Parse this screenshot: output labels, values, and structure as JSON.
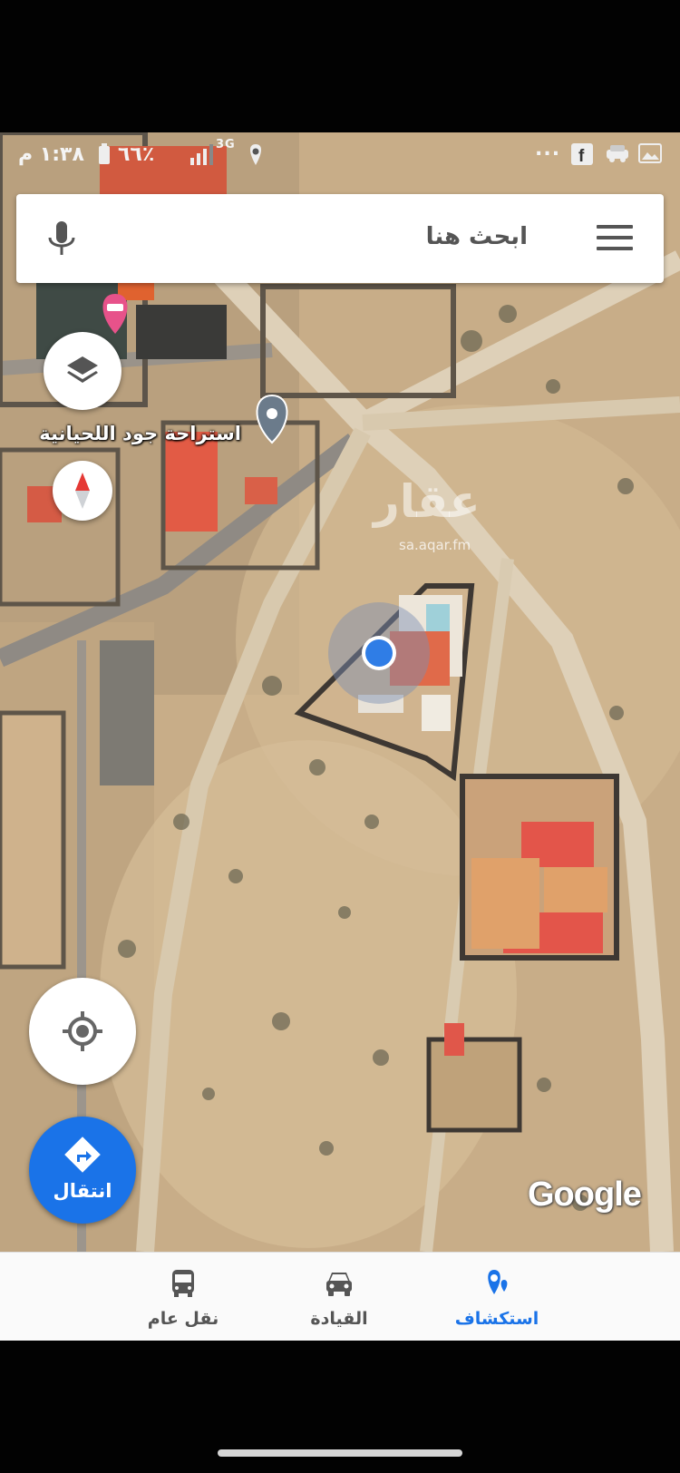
{
  "status_bar": {
    "time": "١:٣٨ م",
    "battery": "٦٦٪",
    "network": "3G"
  },
  "search": {
    "placeholder": "ابحث هنا"
  },
  "map": {
    "place_label": "استراحة جود اللحيانية",
    "watermark_text": "عقار",
    "watermark_url": "sa.aqar.fm",
    "logo_text": "Google"
  },
  "go_button": {
    "label": "انتقال"
  },
  "bottom_nav": {
    "items": [
      {
        "label": "استكشاف",
        "icon": "explore-pin-icon",
        "active": true
      },
      {
        "label": "القيادة",
        "icon": "car-icon",
        "active": false
      },
      {
        "label": "نقل عام",
        "icon": "bus-icon",
        "active": false
      }
    ]
  },
  "colors": {
    "accent": "#1a73e8",
    "nav_active": "#1a73e8",
    "nav_inactive": "#555555",
    "terrain": "#cdb38f"
  }
}
